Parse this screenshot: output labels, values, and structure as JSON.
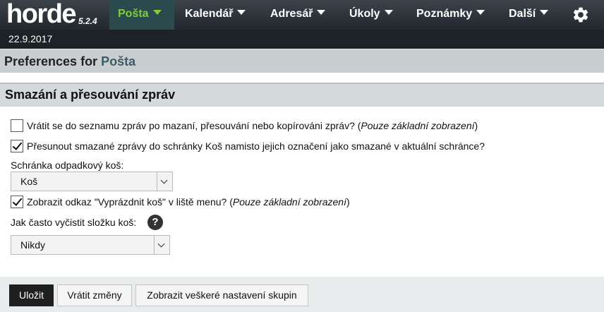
{
  "logo": {
    "word": "horde",
    "version": "5.2.4"
  },
  "nav": [
    {
      "label": "Pošta",
      "active": true
    },
    {
      "label": "Kalendář"
    },
    {
      "label": "Adresář"
    },
    {
      "label": "Úkoly"
    },
    {
      "label": "Poznámky"
    },
    {
      "label": "Další"
    }
  ],
  "settings_icon": "gear-icon",
  "date": "22.9.2017",
  "prefs_header": {
    "prefix": "Preferences for",
    "app": "Pošta"
  },
  "section_title": "Smazání a přesouvání zpráv",
  "options": {
    "return_to_list": {
      "checked": false,
      "label": "Vrátit se do seznamu zpráv po mazaní, přesouvání nebo kopírováni zpráv? (",
      "note": "Pouze základní zobrazení",
      "tail": ")"
    },
    "move_to_trash": {
      "checked": true,
      "label": "Přesunout smazané zprávy do schránky Koš namisto jejich označení jako smazané v aktuální schránce?"
    },
    "trash_folder": {
      "label": "Schránka odpadkový koš:",
      "value": "Koš"
    },
    "empty_trash_link": {
      "checked": true,
      "label": "Zobrazit odkaz \"Vyprázdnit koš\" v liště menu? (",
      "note": "Pouze základní zobrazení",
      "tail": ")"
    },
    "purge_frequency": {
      "label": "Jak často vyčistit složku koš:",
      "value": "Nikdy",
      "help": "?"
    }
  },
  "buttons": {
    "save": "Uložit",
    "revert": "Vrátit změny",
    "show_groups": "Zobrazit veškeré nastavení skupin"
  },
  "colors": {
    "active_nav": "#7fcc3e",
    "topbar": "#2f363b",
    "save_button": "#1f1f1f"
  }
}
